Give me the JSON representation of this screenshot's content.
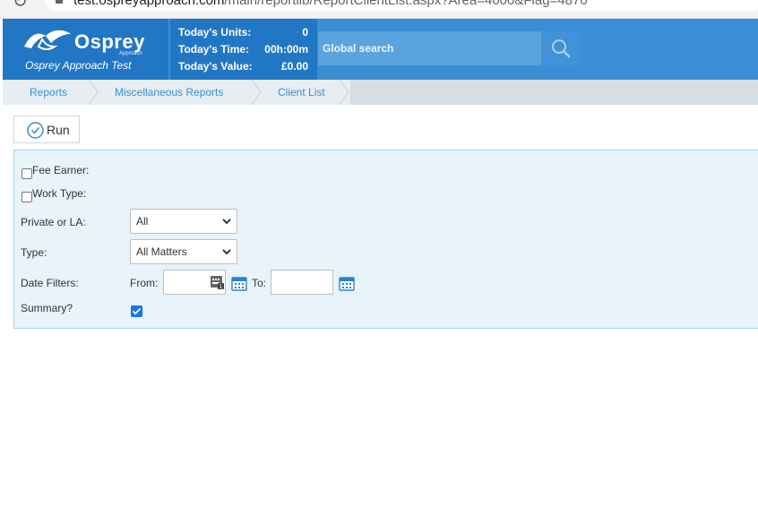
{
  "browser": {
    "url_host": "test.ospreyapproach.com",
    "url_path": "/main/reportlib/ReportClientList.aspx?Area=4000&Flag=4870"
  },
  "header": {
    "brand": "Osprey",
    "brand_sub": "Approach",
    "caption": "Osprey Approach Test",
    "stats": [
      {
        "label": "Today's Units:",
        "value": "0"
      },
      {
        "label": "Today's Time:",
        "value": "00h:00m"
      },
      {
        "label": "Today's Value:",
        "value": "£0.00"
      }
    ],
    "search_placeholder": "Global search",
    "colors": {
      "brand_dark": "#2277c4",
      "brand": "#3a8fd4"
    }
  },
  "breadcrumb": {
    "items": [
      {
        "label": "Reports"
      },
      {
        "label": "Miscellaneous Reports"
      },
      {
        "label": "Client List"
      }
    ]
  },
  "toolbar": {
    "run_label": "Run"
  },
  "filters": {
    "fee_earner_label": "Fee Earner:",
    "work_type_label": "Work Type:",
    "private_or_la_label": "Private or LA:",
    "private_or_la_value": "All",
    "type_label": "Type:",
    "type_value": "All Matters",
    "date_filters_label": "Date Filters:",
    "from_label": "From:",
    "to_label": "To:",
    "summary_label": "Summary?",
    "summary_checked": true,
    "fee_earner_checked": false,
    "work_type_checked": false
  }
}
